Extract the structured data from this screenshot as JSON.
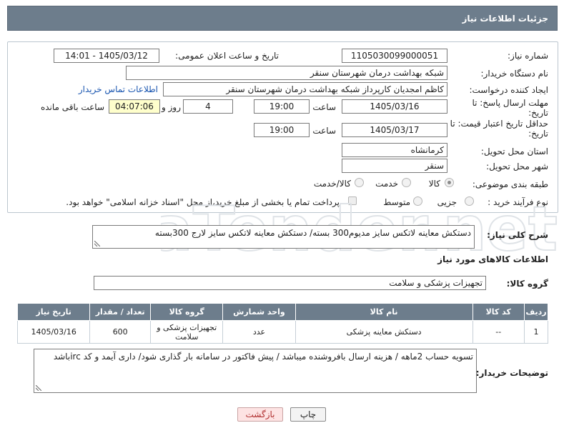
{
  "header": {
    "title": "جزئیات اطلاعات نیاز"
  },
  "form": {
    "need_number_label": "شماره نیاز:",
    "need_number": "1105030099000051",
    "announce_label": "تاریخ و ساعت اعلان عمومی:",
    "announce_value": "1405/03/12 - 14:01",
    "buyer_label": "نام دستگاه خریدار:",
    "buyer_value": "شبکه بهداشت درمان شهرستان سنقر",
    "creator_label": "ایجاد کننده درخواست:",
    "creator_value": "کاظم امجدیان کارپرداز شبکه بهداشت درمان شهرستان سنقر",
    "contact_link": "اطلاعات تماس خریدار",
    "reply_deadline_label": "مهلت ارسال پاسخ: تا تاریخ:",
    "reply_date": "1405/03/16",
    "time_label": "ساعت",
    "reply_time": "19:00",
    "days_value": "4",
    "days_label": "روز و",
    "remaining_time": "04:07:06",
    "remaining_label": "ساعت باقی مانده",
    "validity_label": "حداقل تاریخ اعتبار قیمت: تا تاریخ:",
    "validity_date": "1405/03/17",
    "validity_time": "19:00",
    "province_label": "استان محل تحویل:",
    "province_value": "کرمانشاه",
    "city_label": "شهر محل تحویل:",
    "city_value": "سنقر",
    "category_label": "طبقه بندی موضوعی:",
    "category_options": [
      "کالا",
      "خدمت",
      "کالا/خدمت"
    ],
    "category_selected": "کالا",
    "process_label": "نوع فرآیند خرید :",
    "process_options": [
      "جزیی",
      "متوسط"
    ],
    "payment_note": "پرداخت تمام یا بخشی از مبلغ خرید،از محل \"اسناد خزانه اسلامی\" خواهد بود."
  },
  "summary": {
    "label": "شرح کلی نیاز:",
    "value": "دستکش معاینه لاتکس سایز مدیوم300 بسته/ دستکش معاینه لاتکس سایز لارج 300بسته"
  },
  "goods": {
    "section_title": "اطلاعات کالاهای مورد نیاز",
    "group_label": "گروه کالا:",
    "group_value": "تجهیزات پزشکی و سلامت",
    "columns": [
      "ردیف",
      "کد کالا",
      "نام کالا",
      "واحد شمارش",
      "گروه کالا",
      "تعداد / مقدار",
      "تاریخ نیاز"
    ],
    "rows": [
      [
        "1",
        "--",
        "دستکش معاینه پزشکی",
        "عدد",
        "تجهیزات پزشکی و سلامت",
        "600",
        "1405/03/16"
      ]
    ]
  },
  "buyer_notes": {
    "label": "توضیحات خریدار:",
    "value": "تسویه حساب 2ماهه / هزینه ارسال بافروشنده میباشد / پیش فاکتور در سامانه بار گذاری شود/ داری آیمد و کد ircباشد"
  },
  "buttons": {
    "print": "چاپ",
    "back": "بازگشت"
  },
  "colors": {
    "header_bg": "#6d7d8c",
    "link": "#1a56b0",
    "remaining_bg": "#ffffcc",
    "back_button_bg": "#fde3e3"
  },
  "watermark": {
    "text": "AriaTender.net"
  }
}
